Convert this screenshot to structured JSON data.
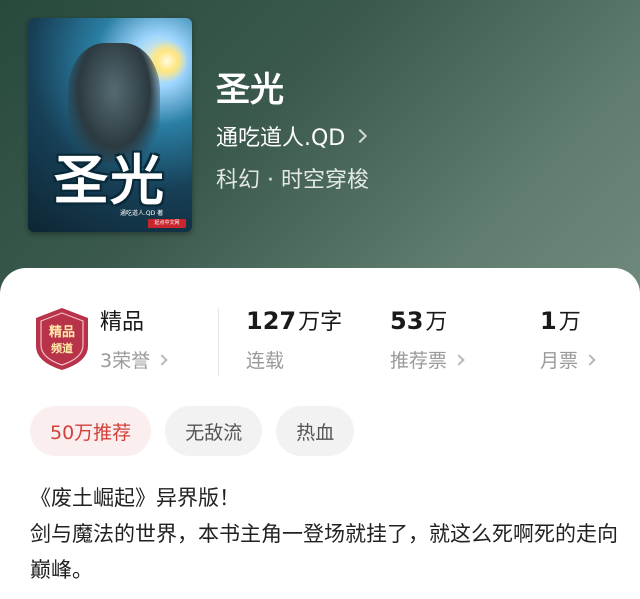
{
  "book": {
    "title": "圣光",
    "author": "通吃道人.QD",
    "genre": "科幻 · 时空穿梭",
    "cover": {
      "title_text": "圣光",
      "author_text": "通吃道人.QD 著",
      "brand_text": "起点中文网"
    }
  },
  "stats": {
    "quality": {
      "label": "精品",
      "sub": "3荣誉",
      "badge_text": "精品频道"
    },
    "words": {
      "number": "127",
      "unit": "万字",
      "sub": "连载"
    },
    "recommend": {
      "number": "53",
      "unit": "万",
      "sub": "推荐票"
    },
    "monthly": {
      "number": "1",
      "unit": "万",
      "sub": "月票"
    }
  },
  "tags": [
    "50万推荐",
    "无敌流",
    "热血"
  ],
  "description": {
    "line1": "《废土崛起》异界版！",
    "line2": "剑与魔法的世界，本书主角一登场就挂了，就这么死啊死的走向巅峰。"
  },
  "colors": {
    "header_bg": "#3b5a4d",
    "hot_tag_text": "#d4403a",
    "hot_tag_bg": "#fbeeee",
    "badge_bg": "#b8324a"
  },
  "icons": {
    "author_chevron": "chevron-right-icon",
    "stat_chevron": "chevron-right-icon",
    "badge": "jingpin-badge-icon"
  }
}
